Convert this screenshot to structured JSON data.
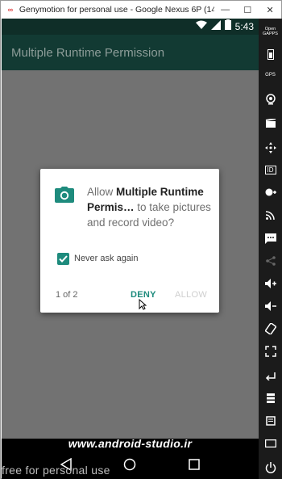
{
  "window": {
    "title": "Genymotion for personal use - Google Nexus 6P (1440x2...",
    "minimize": "—",
    "maximize": "☐",
    "close": "✕"
  },
  "status_bar": {
    "time": "5:43"
  },
  "app_bar": {
    "title": "Multiple Runtime Permission"
  },
  "dialog": {
    "message_prefix": "Allow ",
    "app_name": "Multiple Runtime Permis…",
    "message_suffix": " to take pictures and record video?",
    "checkbox_label": "Never ask again",
    "checkbox_checked": true,
    "counter": "1 of 2",
    "deny_label": "DENY",
    "allow_label": "ALLOW"
  },
  "watermark": "www.android-studio.ir",
  "side_panel": {
    "open_gapps_label": "Open GAPPS",
    "gps_label": "GPS",
    "id_label": "ID"
  },
  "footer": "free for personal use",
  "colors": {
    "accent": "#1e8b7d",
    "app_bar": "#123a33",
    "status_bar": "#0f2e28"
  }
}
